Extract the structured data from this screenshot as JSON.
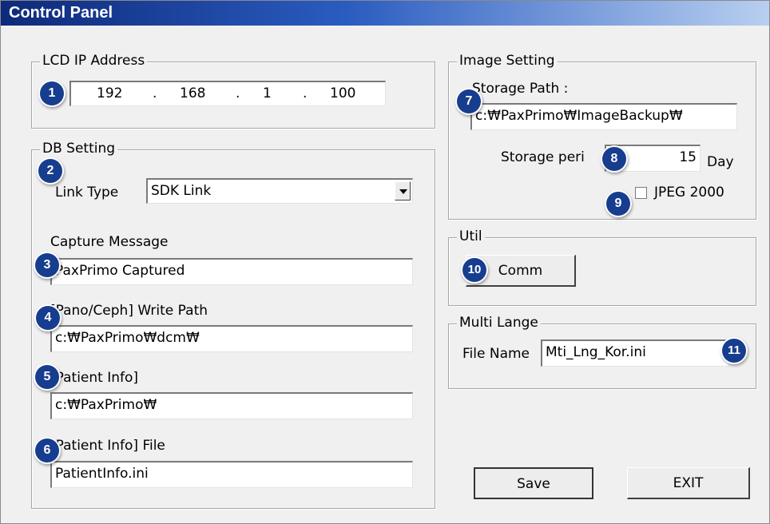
{
  "window": {
    "title": "Control Panel"
  },
  "lcd": {
    "legend": "LCD IP Address",
    "ip": [
      "192",
      "168",
      "1",
      "100"
    ],
    "dots": [
      ".",
      ".",
      "."
    ]
  },
  "db": {
    "legend": "DB Setting",
    "link_type_label": "Link Type",
    "link_type_value": "SDK Link",
    "capture_message_label": "Capture Message",
    "capture_message_value": "PaxPrimo Captured",
    "write_path_label": "[Pano/Ceph] Write Path",
    "write_path_value": "c:₩PaxPrimo₩dcm₩",
    "patient_info_label": "[Patient Info]",
    "patient_info_value": "c:₩PaxPrimo₩",
    "patient_info_file_label": "[Patient Info] File",
    "patient_info_file_value": "PatientInfo.ini"
  },
  "image": {
    "legend": "Image Setting",
    "storage_path_label": "Storage Path :",
    "storage_path_value": "c:₩PaxPrimo₩ImageBackup₩",
    "storage_period_label": "Storage peri",
    "storage_period_value": "15",
    "storage_period_unit": "Day",
    "jpeg_label": "JPEG 2000",
    "jpeg_checked": false
  },
  "util": {
    "legend": "Util",
    "comm_label": "Comm"
  },
  "multilang": {
    "legend": "Multi Lange",
    "file_name_label": "File Name",
    "file_name_value": "Mti_Lng_Kor.ini"
  },
  "actions": {
    "save_label": "Save",
    "exit_label": "EXIT"
  },
  "badges": [
    "1",
    "2",
    "3",
    "4",
    "5",
    "6",
    "7",
    "8",
    "9",
    "10",
    "11"
  ],
  "colors": {
    "title_gradient_start": "#0e2a7a",
    "badge": "#173d8f",
    "background": "#f0f0f0"
  }
}
